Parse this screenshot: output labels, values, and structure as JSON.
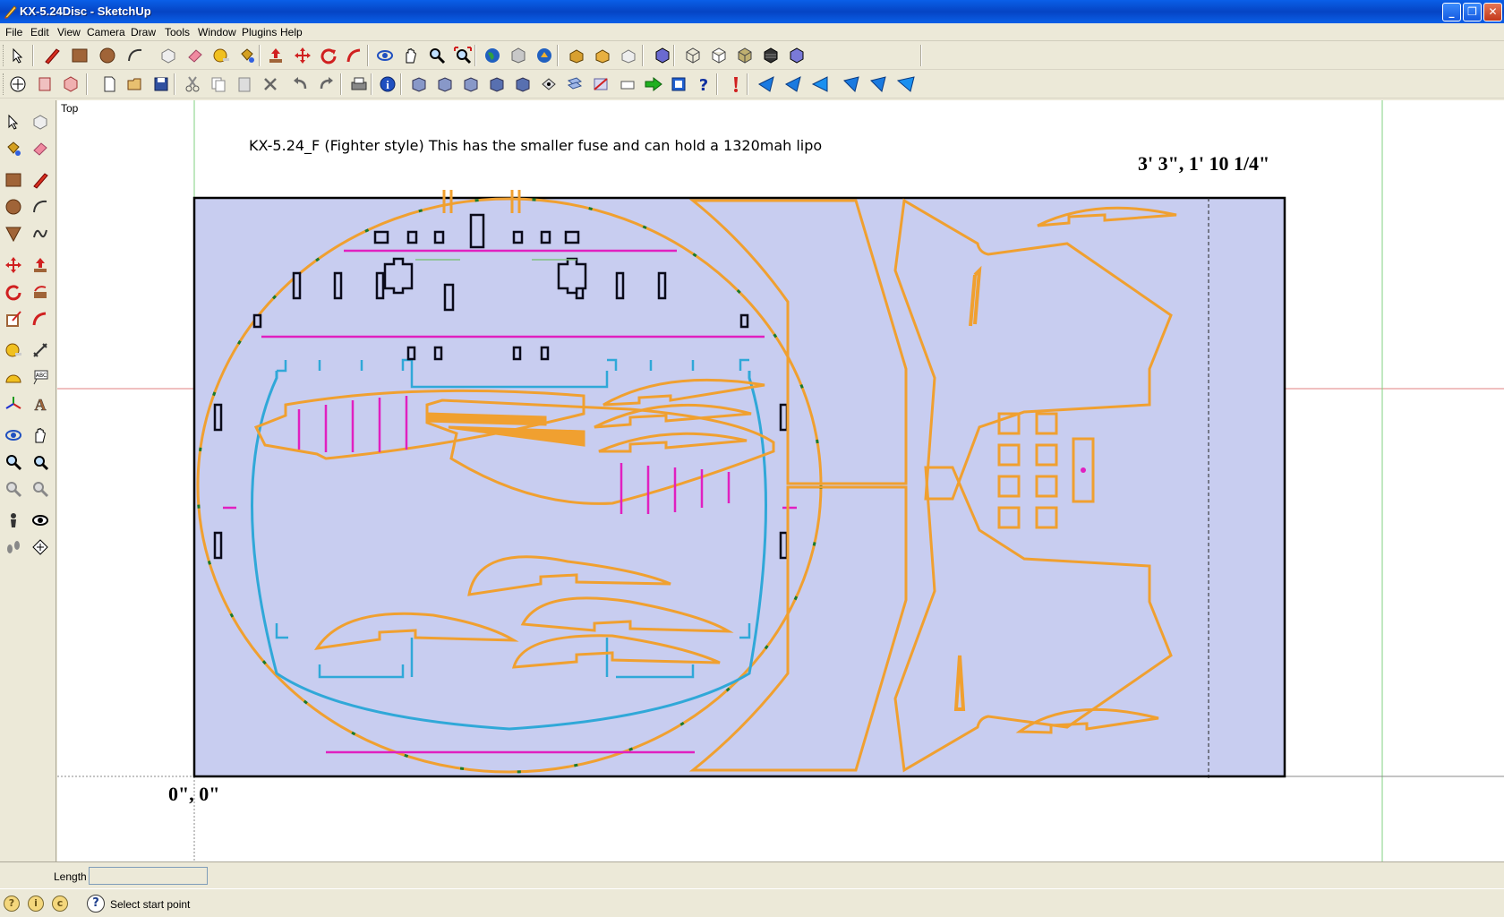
{
  "window": {
    "title": "KX-5.24Disc - SketchUp",
    "controls": [
      "minimize",
      "maximize",
      "close"
    ]
  },
  "menu": {
    "items": [
      "File",
      "Edit",
      "View",
      "Camera",
      "Draw",
      "Tools",
      "Window",
      "Plugins",
      "Help"
    ]
  },
  "toolbar1": {
    "icons": [
      "select-icon",
      "pencil-icon",
      "rectangle-icon",
      "circle-icon",
      "arc-icon",
      "make-component-icon",
      "eraser-icon",
      "tape-measure-icon",
      "paint-bucket-icon",
      "push-pull-icon",
      "move-icon",
      "rotate-icon",
      "follow-me-icon",
      "orbit-icon",
      "pan-icon",
      "zoom-icon",
      "zoom-extents-icon",
      "previous-view-icon",
      "next-view-icon",
      "globe-icon",
      "import-icon",
      "export-icon",
      "share-icon",
      "iso-view-icon",
      "wireframe-icon",
      "hidden-line-icon",
      "shaded-icon",
      "shaded-textures-icon",
      "monochrome-icon",
      "xray-icon"
    ]
  },
  "toolbar2": {
    "icons": [
      "axes-icon",
      "section-plane-icon",
      "section-cuts-icon",
      "new-icon",
      "open-icon",
      "save-icon",
      "cut-icon",
      "copy-icon",
      "paste-icon",
      "delete-icon",
      "undo-icon",
      "redo-icon",
      "print-icon",
      "model-info-icon",
      "front-view-icon",
      "back-view-icon",
      "left-view-icon",
      "right-view-icon",
      "top-view-icon",
      "bottom-view-icon",
      "iso-icon",
      "layers-icon",
      "scenes-icon",
      "comment-icon",
      "arrow-icon",
      "dynamic-components-icon",
      "help-icon",
      "ruby-icon",
      "smooth-icon",
      "unsmooth-icon",
      "hide-icon",
      "show-icon",
      "face-icon",
      "reverse-icon"
    ]
  },
  "lefttoolbar": {
    "icons": [
      "select-icon",
      "make-component-icon",
      "paint-bucket-icon",
      "eraser-icon",
      "rectangle-icon",
      "line-icon",
      "circle-icon",
      "arc-icon",
      "polygon-icon",
      "freehand-icon",
      "move-icon",
      "push-pull-icon",
      "rotate-icon",
      "follow-me-icon",
      "scale-icon",
      "offset-icon",
      "tape-measure-icon",
      "dimension-icon",
      "protractor-icon",
      "text-icon",
      "axes-icon",
      "3d-text-icon",
      "orbit-icon",
      "pan-icon",
      "zoom-icon",
      "zoom-window-icon",
      "previous-icon",
      "zoom-extents-icon",
      "position-camera-icon",
      "look-around-icon",
      "walk-icon",
      "section-plane-icon"
    ]
  },
  "viewport": {
    "view_label": "Top",
    "model_note": "KX-5.24_F (Fighter style) This has the smaller fuse and can hold a 1320mah lipo",
    "dimension_top_right": "3' 3\", 1' 10 1/4\"",
    "dimension_origin": "0\", 0\"",
    "colors": {
      "sheet_fill": "#c8cdf0",
      "part_outline": "#f0a030",
      "inner_ring": "#30a8d8",
      "rib_lines": "#e020c0",
      "axis_red": "#e08080",
      "axis_green": "#80d080"
    }
  },
  "measurements": {
    "label": "Length",
    "value": ""
  },
  "status": {
    "text": "Select start point",
    "icons": [
      "geo-location-icon",
      "credits-icon",
      "sign-in-icon"
    ]
  }
}
